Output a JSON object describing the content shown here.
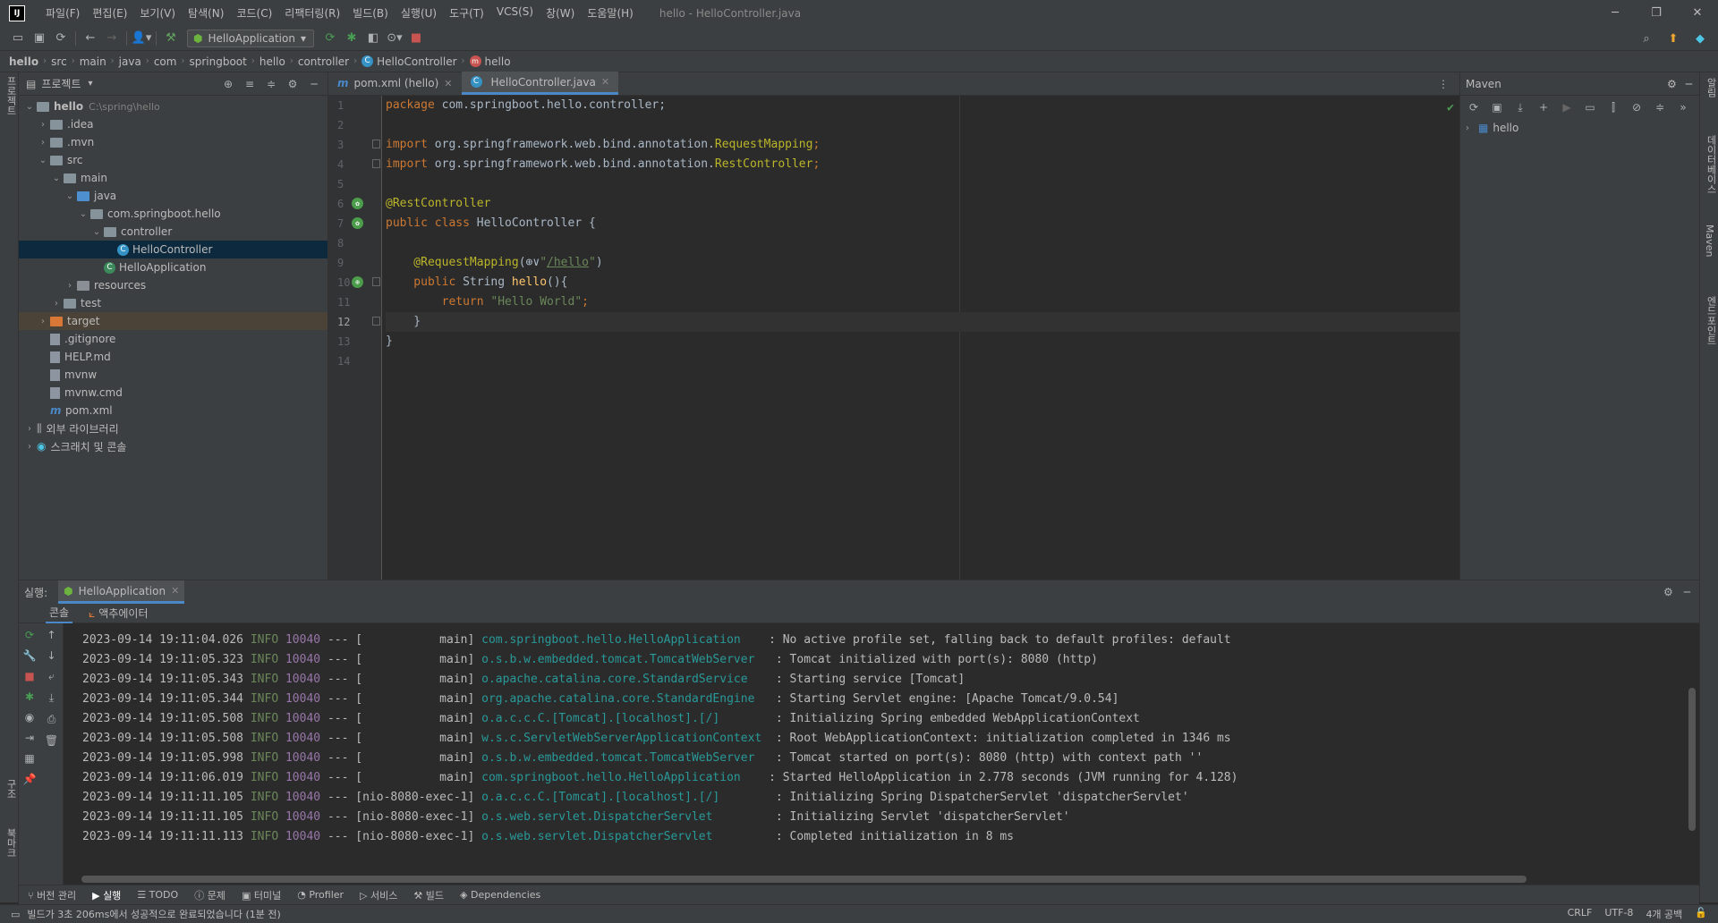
{
  "menubar": {
    "items": [
      "파일(F)",
      "편집(E)",
      "보기(V)",
      "탐색(N)",
      "코드(C)",
      "리팩터링(R)",
      "빌드(B)",
      "실행(U)",
      "도구(T)",
      "VCS(S)",
      "창(W)",
      "도움말(H)"
    ],
    "window_title": "hello - HelloController.java"
  },
  "toolbar": {
    "run_config": "HelloApplication"
  },
  "breadcrumbs": [
    "hello",
    "src",
    "main",
    "java",
    "com",
    "springboot",
    "hello",
    "controller",
    "HelloController",
    "hello"
  ],
  "left_strip": {
    "project": "프로젝트",
    "structure": "구조",
    "bookmarks": "북마크"
  },
  "right_strip": {
    "notifications": "알림",
    "database": "데이터베이스",
    "maven": "Maven",
    "endpoints": "엔드포인트"
  },
  "project": {
    "title": "프로젝트",
    "tree": [
      {
        "label": "hello",
        "extra": "C:\\spring\\hello",
        "depth": 0,
        "arrow": "down",
        "icon": "module"
      },
      {
        "label": ".idea",
        "depth": 1,
        "arrow": "right",
        "icon": "folder"
      },
      {
        "label": ".mvn",
        "depth": 1,
        "arrow": "right",
        "icon": "folder"
      },
      {
        "label": "src",
        "depth": 1,
        "arrow": "down",
        "icon": "folder"
      },
      {
        "label": "main",
        "depth": 2,
        "arrow": "down",
        "icon": "folder"
      },
      {
        "label": "java",
        "depth": 3,
        "arrow": "down",
        "icon": "src"
      },
      {
        "label": "com.springboot.hello",
        "depth": 4,
        "arrow": "down",
        "icon": "folder"
      },
      {
        "label": "controller",
        "depth": 5,
        "arrow": "down",
        "icon": "folder"
      },
      {
        "label": "HelloController",
        "depth": 6,
        "arrow": "",
        "icon": "class",
        "selected": true
      },
      {
        "label": "HelloApplication",
        "depth": 5,
        "arrow": "",
        "icon": "app"
      },
      {
        "label": "resources",
        "depth": 3,
        "arrow": "right",
        "icon": "res"
      },
      {
        "label": "test",
        "depth": 2,
        "arrow": "right",
        "icon": "folder"
      },
      {
        "label": "target",
        "depth": 1,
        "arrow": "right",
        "icon": "target",
        "highlight": true
      },
      {
        "label": ".gitignore",
        "depth": 1,
        "arrow": "",
        "icon": "file"
      },
      {
        "label": "HELP.md",
        "depth": 1,
        "arrow": "",
        "icon": "file"
      },
      {
        "label": "mvnw",
        "depth": 1,
        "arrow": "",
        "icon": "file"
      },
      {
        "label": "mvnw.cmd",
        "depth": 1,
        "arrow": "",
        "icon": "file"
      },
      {
        "label": "pom.xml",
        "depth": 1,
        "arrow": "",
        "icon": "maven"
      },
      {
        "label": "외부 라이브러리",
        "depth": 0,
        "arrow": "right",
        "icon": "lib"
      },
      {
        "label": "스크래치 및 콘솔",
        "depth": 0,
        "arrow": "right",
        "icon": "scratch"
      }
    ]
  },
  "editor": {
    "tabs": [
      {
        "label": "pom.xml (hello)",
        "icon": "maven-icon",
        "active": false
      },
      {
        "label": "HelloController.java",
        "icon": "class-icon",
        "active": true
      }
    ],
    "current_line": 12,
    "lines": [
      [
        [
          "pkg",
          "package "
        ],
        [
          "t",
          "com.springboot.hello.controller;"
        ]
      ],
      [],
      [
        [
          "kw",
          "import "
        ],
        [
          "t",
          "org.springframework.web.bind.annotation."
        ],
        [
          "ann",
          "RequestMapping"
        ],
        [
          "kw",
          ";"
        ]
      ],
      [
        [
          "kw",
          "import "
        ],
        [
          "t",
          "org.springframework.web.bind.annotation."
        ],
        [
          "ann",
          "RestController"
        ],
        [
          "kw",
          ";"
        ]
      ],
      [],
      [
        [
          "ann",
          "@RestController"
        ]
      ],
      [
        [
          "kw",
          "public class "
        ],
        [
          "t",
          "HelloController {"
        ]
      ],
      [],
      [
        [
          "ann",
          "    @RequestMapping"
        ],
        [
          "t",
          "("
        ],
        [
          "t",
          "⊕∨"
        ],
        [
          "str",
          "\""
        ],
        [
          "url",
          "/hello"
        ],
        [
          "str",
          "\""
        ],
        [
          "t",
          ")"
        ]
      ],
      [
        [
          "kw",
          "    public "
        ],
        [
          "t",
          "String "
        ],
        [
          "fn",
          "hello"
        ],
        [
          "t",
          "(){"
        ]
      ],
      [
        [
          "kw",
          "        return "
        ],
        [
          "str",
          "\"Hello World\""
        ],
        [
          "kw",
          ";"
        ]
      ],
      [
        [
          "t",
          "    }"
        ]
      ],
      [
        [
          "t",
          "}"
        ]
      ],
      []
    ]
  },
  "maven": {
    "title": "Maven",
    "root": "hello"
  },
  "run": {
    "label": "실행:",
    "tab": "HelloApplication",
    "subtabs": [
      "콘솔",
      "액추에이터"
    ],
    "logs": [
      {
        "ts": "2023-09-14 19:11:04.026",
        "lv": "INFO",
        "pid": "10040",
        "th": "---",
        "thread": "[           main]",
        "logger": "com.springboot.hello.HelloApplication   ",
        "msg": ": No active profile set, falling back to default profiles: default"
      },
      {
        "ts": "2023-09-14 19:11:05.323",
        "lv": "INFO",
        "pid": "10040",
        "th": "---",
        "thread": "[           main]",
        "logger": "o.s.b.w.embedded.tomcat.TomcatWebServer  ",
        "msg": ": Tomcat initialized with port(s): 8080 (http)"
      },
      {
        "ts": "2023-09-14 19:11:05.343",
        "lv": "INFO",
        "pid": "10040",
        "th": "---",
        "thread": "[           main]",
        "logger": "o.apache.catalina.core.StandardService   ",
        "msg": ": Starting service [Tomcat]"
      },
      {
        "ts": "2023-09-14 19:11:05.344",
        "lv": "INFO",
        "pid": "10040",
        "th": "---",
        "thread": "[           main]",
        "logger": "org.apache.catalina.core.StandardEngine  ",
        "msg": ": Starting Servlet engine: [Apache Tomcat/9.0.54]"
      },
      {
        "ts": "2023-09-14 19:11:05.508",
        "lv": "INFO",
        "pid": "10040",
        "th": "---",
        "thread": "[           main]",
        "logger": "o.a.c.c.C.[Tomcat].[localhost].[/]       ",
        "msg": ": Initializing Spring embedded WebApplicationContext"
      },
      {
        "ts": "2023-09-14 19:11:05.508",
        "lv": "INFO",
        "pid": "10040",
        "th": "---",
        "thread": "[           main]",
        "logger": "w.s.c.ServletWebServerApplicationContext ",
        "msg": ": Root WebApplicationContext: initialization completed in 1346 ms"
      },
      {
        "ts": "2023-09-14 19:11:05.998",
        "lv": "INFO",
        "pid": "10040",
        "th": "---",
        "thread": "[           main]",
        "logger": "o.s.b.w.embedded.tomcat.TomcatWebServer  ",
        "msg": ": Tomcat started on port(s): 8080 (http) with context path ''"
      },
      {
        "ts": "2023-09-14 19:11:06.019",
        "lv": "INFO",
        "pid": "10040",
        "th": "---",
        "thread": "[           main]",
        "logger": "com.springboot.hello.HelloApplication   ",
        "msg": ": Started HelloApplication in 2.778 seconds (JVM running for 4.128)"
      },
      {
        "ts": "2023-09-14 19:11:11.105",
        "lv": "INFO",
        "pid": "10040",
        "th": "---",
        "thread": "[nio-8080-exec-1]",
        "logger": "o.a.c.c.C.[Tomcat].[localhost].[/]       ",
        "msg": ": Initializing Spring DispatcherServlet 'dispatcherServlet'"
      },
      {
        "ts": "2023-09-14 19:11:11.105",
        "lv": "INFO",
        "pid": "10040",
        "th": "---",
        "thread": "[nio-8080-exec-1]",
        "logger": "o.s.web.servlet.DispatcherServlet        ",
        "msg": ": Initializing Servlet 'dispatcherServlet'"
      },
      {
        "ts": "2023-09-14 19:11:11.113",
        "lv": "INFO",
        "pid": "10040",
        "th": "---",
        "thread": "[nio-8080-exec-1]",
        "logger": "o.s.web.servlet.DispatcherServlet        ",
        "msg": ": Completed initialization in 8 ms"
      }
    ]
  },
  "bottom_tools": [
    "버전 관리",
    "실행",
    "TODO",
    "문제",
    "터미널",
    "Profiler",
    "서비스",
    "빌드",
    "Dependencies"
  ],
  "status": {
    "message": "빌드가 3초 206ms에서 성공적으로 완료되었습니다 (1분 전)",
    "line_sep": "CRLF",
    "encoding": "UTF-8",
    "indent": "4개 공백"
  }
}
